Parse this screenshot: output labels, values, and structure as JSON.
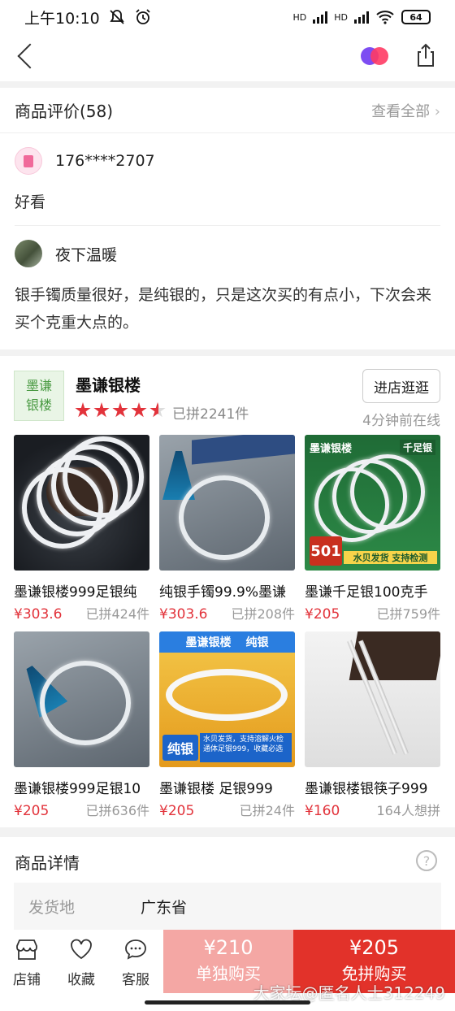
{
  "status_bar": {
    "time": "上午10:10",
    "network_1": "HD",
    "network_2": "HD",
    "battery": "64"
  },
  "nav": {
    "back_icon": "chevron-left-icon",
    "brand_icon": "overlapping-circles-icon",
    "share_icon": "share-icon"
  },
  "reviews": {
    "title": "商品评价(58)",
    "view_all": "查看全部",
    "items": [
      {
        "user": "176****2707",
        "text": "好看"
      },
      {
        "user": "夜下温暖",
        "text": "银手镯质量很好，是纯银的，只是这次买的有点小，下次会来买个克重大点的。"
      }
    ]
  },
  "shop": {
    "logo_text_1": "墨谦",
    "logo_text_2": "银楼",
    "name": "墨谦银楼",
    "rating": 4.5,
    "sold": "已拼2241件",
    "visit_button": "进店逛逛",
    "online": "4分钟前在线",
    "products": [
      {
        "title": "墨谦银楼999足银纯",
        "price": "¥303.6",
        "sold": "已拼424件"
      },
      {
        "title": "纯银手镯99.9%墨谦",
        "price": "¥303.6",
        "sold": "已拼208件"
      },
      {
        "title": "墨谦千足银100克手",
        "price": "¥205",
        "sold": "已拼759件",
        "img_label_top": "墨谦银楼",
        "img_label_right": "千足银",
        "img_price": "501",
        "img_strip": "水贝发货 支持检测"
      },
      {
        "title": "墨谦银楼999足银10",
        "price": "¥205",
        "sold": "已拼636件"
      },
      {
        "title": "墨谦银楼 足银999",
        "price": "¥205",
        "sold": "已拼24件",
        "img_label_top": "墨谦银楼",
        "img_label_right": "纯银",
        "img_badge": "纯银",
        "img_strip": "水贝发货，支持溶解火检 通体足银999，收藏必选"
      },
      {
        "title": "墨谦银楼银筷子999",
        "price": "¥160",
        "sold": "164人想拼"
      }
    ]
  },
  "details": {
    "title": "商品详情",
    "help_icon": "question-circle-icon",
    "ship_from_label": "发货地",
    "ship_from_value": "广东省"
  },
  "bottom_bar": {
    "store": "店铺",
    "favorite": "收藏",
    "service": "客服",
    "single_price": "¥210",
    "single_label": "单独购买",
    "group_price": "¥205",
    "group_label": "免拼购买"
  },
  "watermark": "大家坛@匿名人士312249",
  "colors": {
    "accent_red": "#e2333b",
    "buy_single": "#f4a7a4",
    "buy_group": "#e2322a",
    "shop_green": "#4a9a43"
  }
}
